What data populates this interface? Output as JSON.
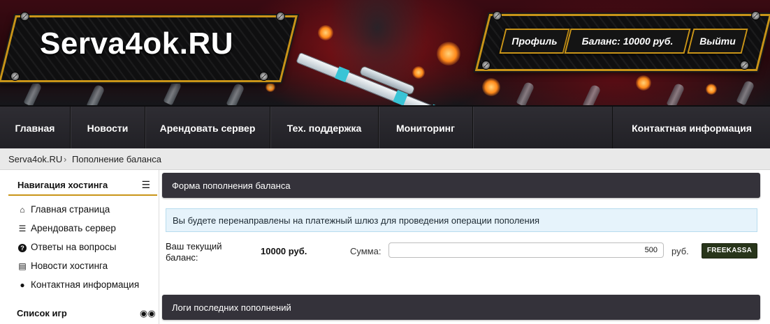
{
  "brand": {
    "logo_text": "Serva4ok.RU",
    "accent": "#c99418"
  },
  "top_actions": {
    "profile": "Профиль",
    "balance": "Баланс: 10000 руб.",
    "logout": "Выйти"
  },
  "nav": {
    "items": [
      "Главная",
      "Новости",
      "Арендовать сервер",
      "Тех. поддержка",
      "Мониторинг",
      "Контактная информация"
    ]
  },
  "breadcrumb": {
    "home": "Serva4ok.RU",
    "separator": "›",
    "current": "Пополнение баланса"
  },
  "sidebar": {
    "header": "Навигация хостинга",
    "header_icon": "list-icon",
    "links": [
      {
        "label": "Главная страница",
        "icon": "home-icon"
      },
      {
        "label": "Арендовать сервер",
        "icon": "server-icon"
      },
      {
        "label": "Ответы на вопросы",
        "icon": "question-icon"
      },
      {
        "label": "Новости хостинга",
        "icon": "newspaper-icon"
      },
      {
        "label": "Контактная информация",
        "icon": "chat-icon"
      }
    ],
    "games_header": "Список игр",
    "games_icon": "gamepad-icon"
  },
  "main": {
    "form_title": "Форма пополнения баланса",
    "info_text": "Вы будете перенаправлены на платежный шлюз для проведения операции пополения",
    "balance_label": "Ваш текущий баланс:",
    "balance_value": "10000 руб.",
    "sum_label": "Сумма:",
    "sum_value": "500",
    "currency": "руб.",
    "pay_button": "FREEKASSA",
    "logs_title": "Логи последних пополнений"
  }
}
